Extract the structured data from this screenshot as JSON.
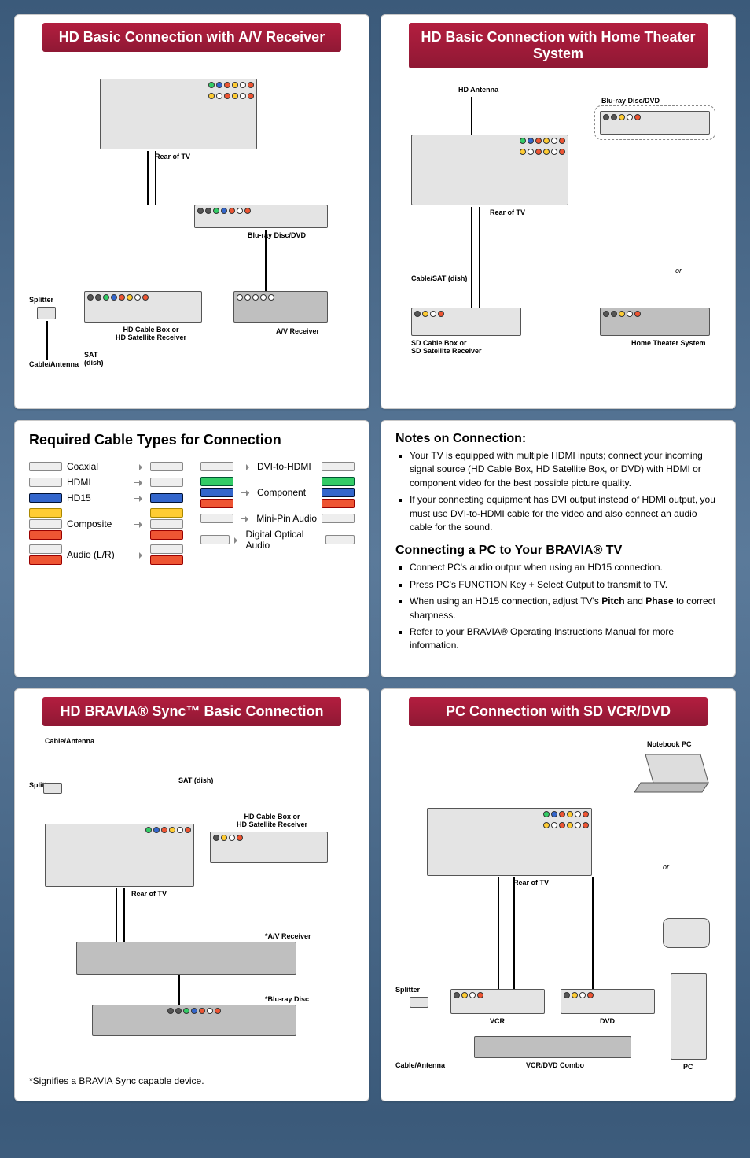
{
  "cards": {
    "c1": {
      "title": "HD Basic Connection with A/V Receiver"
    },
    "c2": {
      "title": "HD Basic Connection with Home Theater System"
    },
    "c3": {
      "title": "HD BRAVIA® Sync™ Basic Connection"
    },
    "c4": {
      "title": "PC Connection with SD VCR/DVD"
    }
  },
  "diag1": {
    "rear_of_tv": "Rear of TV",
    "bluray": "Blu-ray Disc/DVD",
    "splitter": "Splitter",
    "cable_antenna": "Cable/Antenna",
    "sat_dish": "SAT\n(dish)",
    "hd_box": "HD Cable Box or\nHD Satellite Receiver",
    "avr": "A/V Receiver"
  },
  "diag2": {
    "hd_antenna": "HD Antenna",
    "bluray": "Blu-ray Disc/DVD",
    "rear_of_tv": "Rear of TV",
    "cable_sat": "Cable/SAT (dish)",
    "sd_box": "SD Cable Box or\nSD Satellite Receiver",
    "hts": "Home Theater System",
    "or": "or"
  },
  "cables": {
    "heading": "Required Cable Types for Connection",
    "left": [
      "Coaxial",
      "HDMI",
      "HD15",
      "Composite",
      "Audio (L/R)"
    ],
    "right": [
      "DVI-to-HDMI",
      "Component",
      "Mini-Pin Audio",
      "Digital Optical Audio"
    ]
  },
  "notes": {
    "heading": "Notes on Connection:",
    "items": [
      "Your TV is equipped with multiple HDMI inputs; connect your incoming signal source (HD Cable Box, HD Satellite Box, or DVD) with HDMI or component video for the best possible picture quality.",
      "If your connecting equipment has DVI output instead of HDMI output, you must use DVI-to-HDMI cable for the video and also connect an audio cable for the sound."
    ],
    "pc_heading": "Connecting a PC to Your BRAVIA® TV",
    "pc_items": [
      "Connect PC's audio output when using an HD15 connection.",
      "Press PC's FUNCTION Key + Select Output to transmit to TV.",
      "When using an HD15 connection, adjust TV's <b>Pitch</b> and <b>Phase</b> to correct sharpness.",
      "Refer to your BRAVIA® Operating Instructions Manual for more information."
    ]
  },
  "diag3": {
    "cable_antenna": "Cable/Antenna",
    "splitter": "Splitter",
    "sat_dish": "SAT (dish)",
    "hd_box": "HD Cable Box or\nHD Satellite Receiver",
    "rear_of_tv": "Rear of TV",
    "avr": "*A/V Receiver",
    "bluray": "*Blu-ray Disc",
    "footnote": "*Signifies a BRAVIA Sync capable device."
  },
  "diag4": {
    "notebook": "Notebook PC",
    "rear_of_tv": "Rear of TV",
    "or": "or",
    "splitter": "Splitter",
    "cable_antenna": "Cable/Antenna",
    "vcr": "VCR",
    "dvd": "DVD",
    "combo": "VCR/DVD Combo",
    "pc": "PC"
  }
}
